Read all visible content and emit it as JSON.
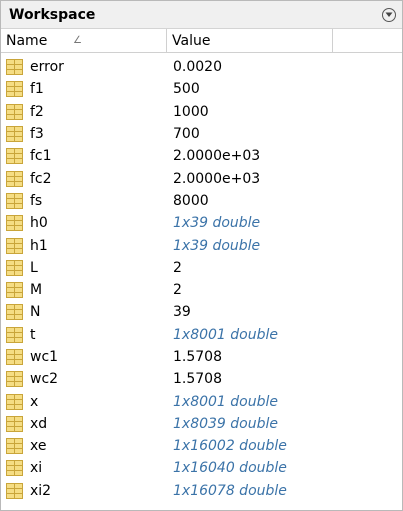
{
  "panel": {
    "title": "Workspace",
    "menu_icon": "chevron-down-circle-icon"
  },
  "columns": {
    "name": "Name",
    "name_sort_icon": "sort-ascending-icon",
    "value": "Value"
  },
  "variables": [
    {
      "name": "error",
      "value": "0.0020",
      "kind": "scalar"
    },
    {
      "name": "f1",
      "value": "500",
      "kind": "scalar"
    },
    {
      "name": "f2",
      "value": "1000",
      "kind": "scalar"
    },
    {
      "name": "f3",
      "value": "700",
      "kind": "scalar"
    },
    {
      "name": "fc1",
      "value": "2.0000e+03",
      "kind": "scalar"
    },
    {
      "name": "fc2",
      "value": "2.0000e+03",
      "kind": "scalar"
    },
    {
      "name": "fs",
      "value": "8000",
      "kind": "scalar"
    },
    {
      "name": "h0",
      "value": "1x39 double",
      "kind": "matrix"
    },
    {
      "name": "h1",
      "value": "1x39 double",
      "kind": "matrix"
    },
    {
      "name": "L",
      "value": "2",
      "kind": "scalar"
    },
    {
      "name": "M",
      "value": "2",
      "kind": "scalar"
    },
    {
      "name": "N",
      "value": "39",
      "kind": "scalar"
    },
    {
      "name": "t",
      "value": "1x8001 double",
      "kind": "matrix"
    },
    {
      "name": "wc1",
      "value": "1.5708",
      "kind": "scalar"
    },
    {
      "name": "wc2",
      "value": "1.5708",
      "kind": "scalar"
    },
    {
      "name": "x",
      "value": "1x8001 double",
      "kind": "matrix"
    },
    {
      "name": "xd",
      "value": "1x8039 double",
      "kind": "matrix"
    },
    {
      "name": "xe",
      "value": "1x16002 double",
      "kind": "matrix"
    },
    {
      "name": "xi",
      "value": "1x16040 double",
      "kind": "matrix"
    },
    {
      "name": "xi2",
      "value": "1x16078 double",
      "kind": "matrix"
    }
  ],
  "colors": {
    "matrix_value": "#3b73a8",
    "icon_fill": "#f5dd84",
    "icon_border": "#c9a53a"
  }
}
